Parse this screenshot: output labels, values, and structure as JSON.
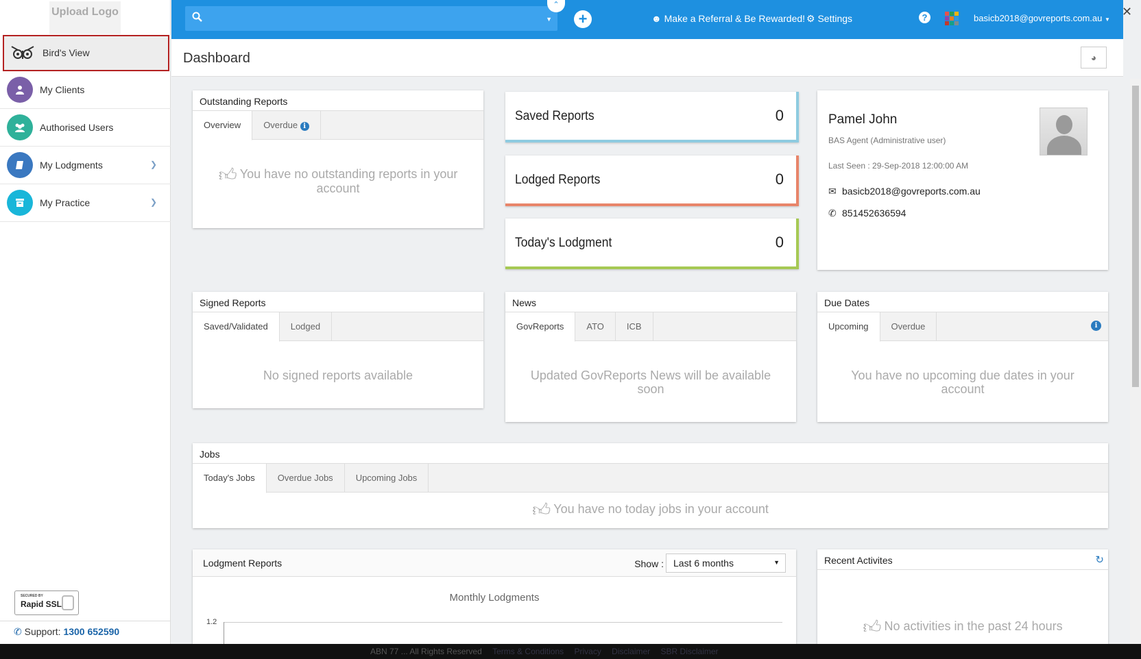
{
  "sidebar": {
    "logo_text": "Upload Logo",
    "items": [
      {
        "label": "Bird's View",
        "color": "#555555"
      },
      {
        "label": "My Clients",
        "color": "#7a5fa8"
      },
      {
        "label": "Authorised Users",
        "color": "#2fb19a"
      },
      {
        "label": "My Lodgments",
        "color": "#3a78c0"
      },
      {
        "label": "My Practice",
        "color": "#19b6d9"
      }
    ],
    "ssl_secured": "SECURED BY",
    "ssl_brand": "Rapid SSL",
    "support_label": "Support:",
    "support_phone": "1300 652590"
  },
  "topbar": {
    "referral": "Make a Referral & Be Rewarded!",
    "settings": "Settings",
    "user_email": "basicb2018@govreports.com.au"
  },
  "header": {
    "title": "Dashboard"
  },
  "outstanding": {
    "title": "Outstanding Reports",
    "tabs": [
      "Overview",
      "Overdue"
    ],
    "empty": "You have no outstanding reports in your account"
  },
  "stats": [
    {
      "label": "Saved Reports",
      "value": "0",
      "accent": "#8ecbe0"
    },
    {
      "label": "Lodged Reports",
      "value": "0",
      "accent": "#e8856a"
    },
    {
      "label": "Today's Lodgment",
      "value": "0",
      "accent": "#a6c954"
    }
  ],
  "profile": {
    "name": "Pamel John",
    "role": "BAS Agent (Administrative user)",
    "last_seen": "Last Seen : 29-Sep-2018 12:00:00 AM",
    "email": "basicb2018@govreports.com.au",
    "phone": "851452636594"
  },
  "signed": {
    "title": "Signed Reports",
    "tabs": [
      "Saved/Validated",
      "Lodged"
    ],
    "empty": "No signed reports available"
  },
  "news": {
    "title": "News",
    "tabs": [
      "GovReports",
      "ATO",
      "ICB"
    ],
    "empty": "Updated GovReports News will be available soon"
  },
  "due": {
    "title": "Due Dates",
    "tabs": [
      "Upcoming",
      "Overdue"
    ],
    "empty": "You have no upcoming due dates in your account"
  },
  "jobs": {
    "title": "Jobs",
    "tabs": [
      "Today's Jobs",
      "Overdue Jobs",
      "Upcoming Jobs"
    ],
    "empty": "You have no today jobs in your account"
  },
  "lodgment": {
    "title": "Lodgment Reports",
    "show_label": "Show :",
    "period": "Last 6 months",
    "chart_title": "Monthly Lodgments",
    "y_tick": "1.2"
  },
  "recent": {
    "title": "Recent Activites",
    "empty": "No activities in the past 24 hours"
  },
  "footer": {
    "text": "ABN 77 ... All Rights Reserved",
    "links": [
      "Terms & Conditions",
      "Privacy",
      "Disclaimer",
      "SBR Disclaimer"
    ]
  }
}
